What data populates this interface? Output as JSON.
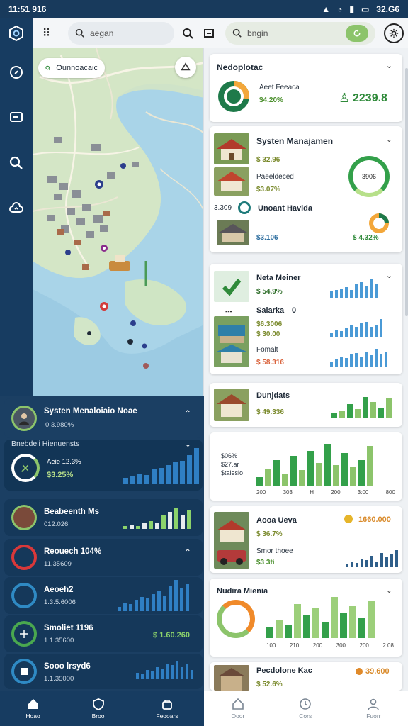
{
  "status_bar": {
    "time": "11:51 916",
    "right": "32.G6"
  },
  "topbar": {
    "search_left_placeholder": "aegan",
    "search_right_placeholder": "bngin"
  },
  "map": {
    "chip_label": "Ounnoacaic"
  },
  "left_panel": {
    "card1": {
      "title": "Systen Menaloiaio Noae",
      "sub": "0.3.980%"
    },
    "card2": {
      "title": "Bnebdeli Hienuensts",
      "line1": "Aeie 12.3%",
      "line2": "$3.25%"
    },
    "card3": {
      "title": "Beabeenth Ms",
      "sub": "012.026"
    },
    "card4": {
      "title": "Reouech 104%",
      "sub": "11.35609"
    },
    "card5": {
      "title": "Aeoeh2",
      "sub": "1.3.5.6006"
    },
    "card6": {
      "title": "Smoliet 1196",
      "sub": "1.1.35600",
      "value": "$ 1.60.260"
    },
    "card7": {
      "title": "Sooo lrsyd6",
      "sub": "1.1.35000"
    }
  },
  "right_panel": {
    "card1": {
      "title": "Nedoplotac",
      "line1": "Aeet Feeaca",
      "line2": "$4.20%",
      "value": "2239.8"
    },
    "card2": {
      "title": "Systen Manajamen",
      "line1": "$ 32.96",
      "line2": "Paeeldeced",
      "line3": "$3.07%",
      "ring": "3906",
      "sub_title": "Unoant Havida",
      "sub_prefix": "3.309",
      "value_left": "$3.106",
      "value_right": "$ 4.32%"
    },
    "card3": {
      "title": "Neta Meiner",
      "line1": "$ 54.9%",
      "title2": "Saiarka",
      "badge": "0",
      "line2": "$6.3006",
      "line3": "$ 30.00",
      "title3": "Fomalt",
      "line4": "$ 58.316"
    },
    "card4": {
      "title": "Dunjdats",
      "line1": "$ 49.336"
    },
    "card5": {
      "labels": [
        "$06%",
        "$27.ar",
        "$taleslo"
      ],
      "ticks": [
        "200",
        "303",
        "H",
        "200",
        "3:00",
        "800"
      ]
    },
    "card6": {
      "title": "Aooa Ueva",
      "line1": "$ 36.7%",
      "line2": "Smor thoee",
      "line3": "$3 3ti",
      "value": "1660.000"
    },
    "card7": {
      "title": "Nudira Mienia",
      "ticks": [
        "100",
        "210",
        "200",
        "300",
        "200",
        "2.08"
      ]
    },
    "card8": {
      "title": "Pecdolone Kac",
      "line1": "$ 52.6%",
      "value": "39.600"
    }
  },
  "bottom_nav": {
    "left": [
      {
        "label": "Hoao"
      },
      {
        "label": "Broo"
      },
      {
        "label": "Feooars"
      }
    ],
    "right": [
      {
        "label": "Ooor"
      },
      {
        "label": "Cors"
      },
      {
        "label": "Fuorr"
      }
    ]
  },
  "chart_data": [
    {
      "type": "bar",
      "values": [
        4,
        5,
        7,
        6,
        10,
        11,
        13,
        15,
        16,
        20,
        25
      ]
    },
    {
      "type": "bar",
      "values": [
        2,
        3,
        2,
        4,
        5,
        4,
        9,
        11,
        14,
        9,
        12
      ]
    },
    {
      "type": "bar",
      "values": [
        3,
        6,
        5,
        8,
        10,
        9,
        12,
        14,
        11,
        18,
        22,
        16,
        19
      ]
    },
    {
      "type": "bar",
      "values": [
        4,
        3,
        6,
        5,
        8,
        7,
        10,
        9,
        12,
        8,
        10,
        6
      ]
    },
    {
      "type": "bar",
      "values": [
        5,
        6,
        7,
        8,
        6,
        10,
        12,
        9,
        14,
        11
      ]
    },
    {
      "type": "bar",
      "values": [
        3,
        5,
        4,
        6,
        8,
        7,
        9,
        10,
        7,
        8,
        12
      ]
    },
    {
      "type": "bar",
      "values": [
        4,
        6,
        8,
        7,
        10,
        11,
        8,
        12,
        9,
        14,
        10,
        12
      ]
    },
    {
      "type": "bar",
      "values": [
        3,
        4,
        8,
        5,
        12,
        9,
        6,
        11
      ]
    },
    {
      "type": "bar",
      "values": [
        8,
        15,
        22,
        10,
        26,
        14,
        30,
        20,
        36,
        18,
        28,
        16,
        22,
        34
      ]
    },
    {
      "type": "bar",
      "values": [
        2,
        4,
        3,
        6,
        5,
        8,
        4,
        10,
        7,
        9,
        12
      ]
    },
    {
      "type": "bar",
      "values": [
        10,
        16,
        12,
        30,
        20,
        26,
        14,
        36,
        22,
        28,
        18,
        32
      ]
    },
    {
      "type": "pie",
      "values": [
        72,
        28
      ]
    }
  ]
}
